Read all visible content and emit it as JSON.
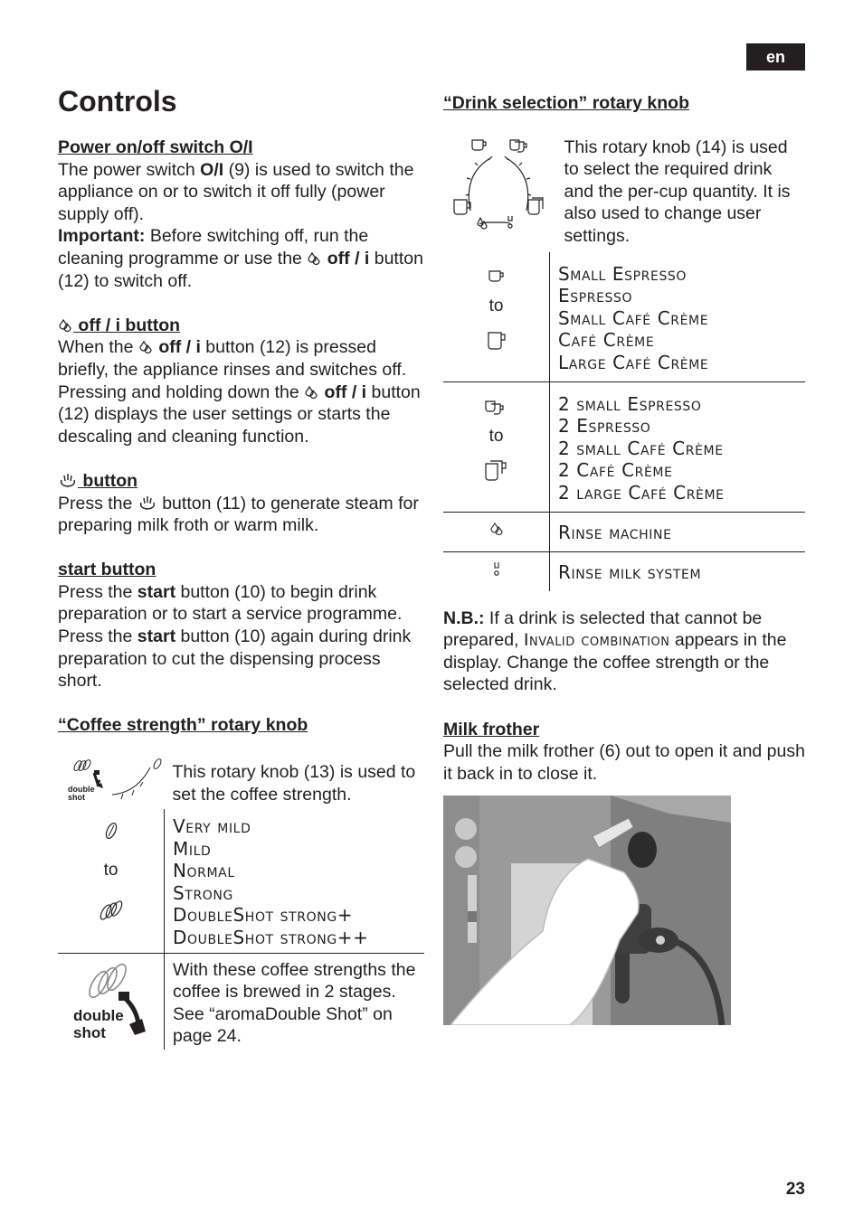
{
  "header": {
    "language_badge": "en",
    "page_number": "23"
  },
  "title": "Controls",
  "left": {
    "power": {
      "heading": "Power on/off switch O/I",
      "p1_a": "The power switch ",
      "p1_b": "O/I",
      "p1_c": " (9) is used to switch the appliance on or to switch it off fully (power supply off).",
      "important_label": "Important:",
      "p2_a": " Before switching off, run the cleaning programme or use the ",
      "p2_btn": "off / i",
      "p2_b": " button (12) to switch off."
    },
    "off_i": {
      "heading": "off / i button",
      "p1_a": "When the ",
      "p1_btn": "off / i",
      "p1_b": " button (12) is pressed briefly, the appliance rinses and switches off. Pressing and holding down the ",
      "p1_btn2": "off / i",
      "p1_c": " button (12) displays the user settings or starts the descaling and cleaning function."
    },
    "steam": {
      "heading": "button",
      "p1_a": "Press the ",
      "p1_b": " button (11) to generate steam for preparing milk froth or warm milk."
    },
    "start": {
      "heading": "start button",
      "p1_a": "Press the ",
      "p1_b": "start",
      "p1_c": " button (10) to begin drink preparation or to start a service programme. Press the ",
      "p1_d": "start",
      "p1_e": " button (10) again during drink preparation to cut the dispensing process short."
    },
    "strength": {
      "heading": "“Coffee strength” rotary knob",
      "knob_label_1": "double",
      "knob_label_2": "shot",
      "intro": "This rotary knob (13) is used to set the coffee strength.",
      "to": "to",
      "options": [
        "Very mild",
        "Mild",
        "Normal",
        "Strong",
        "DoubleShot strong+",
        "DoubleShot strong++"
      ],
      "ds_label_1": "double",
      "ds_label_2": "shot",
      "ds_text": "With these coffee strengths the coffee is brewed in 2 stages. See “aromaDouble Shot” on page 24."
    }
  },
  "right": {
    "drink": {
      "heading": "“Drink selection” rotary knob",
      "intro": "This rotary knob (14) is used to select the required drink and the per-cup quantity. It is also used to change user settings.",
      "to": "to",
      "single_options": [
        "Small Espresso",
        "Espresso",
        "Small Café Crème",
        "Café Crème",
        "Large Café Crème"
      ],
      "double_options": [
        "2 small Espresso",
        "2 Espresso",
        "2 small Café Crème",
        "2 Café Crème",
        "2 large Café Crème"
      ],
      "rinse_machine": "Rinse machine",
      "rinse_milk": "Rinse milk system"
    },
    "nb": {
      "label": "N.B.:",
      "text_a": " If a drink is selected that cannot be prepared, ",
      "display_msg": "Invalid combination",
      "text_b": " appears in the display. Change the coffee strength or the selected drink."
    },
    "frother": {
      "heading": "Milk frother",
      "text": "Pull the milk frother (6) out to open it and push it back in to close it."
    }
  }
}
